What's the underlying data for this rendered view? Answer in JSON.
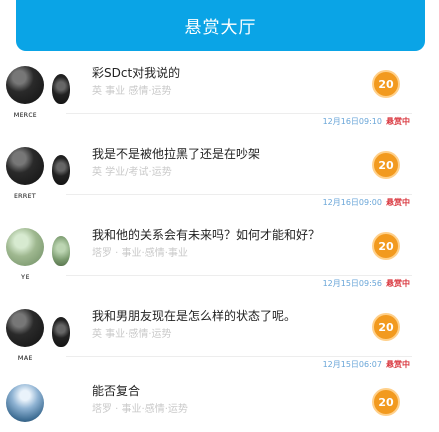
{
  "header": {
    "title": "悬赏大厅"
  },
  "items": [
    {
      "avatar": "dark",
      "avatar_name": "ᴍᴇʀᴄᴇ",
      "title": "彩SDct对我说的",
      "tags": "英 事业 感情·运势",
      "reward": "20",
      "time": "12月16日09:10",
      "status": "悬赏中"
    },
    {
      "avatar": "dark",
      "avatar_name": "ᴇʀʀᴇᴛ",
      "title": "我是不是被他拉黑了还是在吵架",
      "tags": "英 学业/考试·运势",
      "reward": "20",
      "time": "12月16日09:00",
      "status": "悬赏中"
    },
    {
      "avatar": "alt",
      "avatar_name": "ʏᴇ",
      "title": "我和他的关系会有未来吗？如何才能和好？",
      "tags": "塔罗 · 事业·感情·事业",
      "reward": "20",
      "time": "12月15日09:56",
      "status": "悬赏中"
    },
    {
      "avatar": "dark",
      "avatar_name": "ᴍᴀᴇ",
      "title": "我和男朋友现在是怎么样的状态了呢。",
      "tags": "英 事业·感情·运势",
      "reward": "20",
      "time": "12月15日06:07",
      "status": "悬赏中"
    },
    {
      "avatar": "sky",
      "avatar_name": "",
      "title": "能否复合",
      "tags": "塔罗 · 事业·感情·运势",
      "reward": "20",
      "time": "",
      "status": ""
    }
  ]
}
